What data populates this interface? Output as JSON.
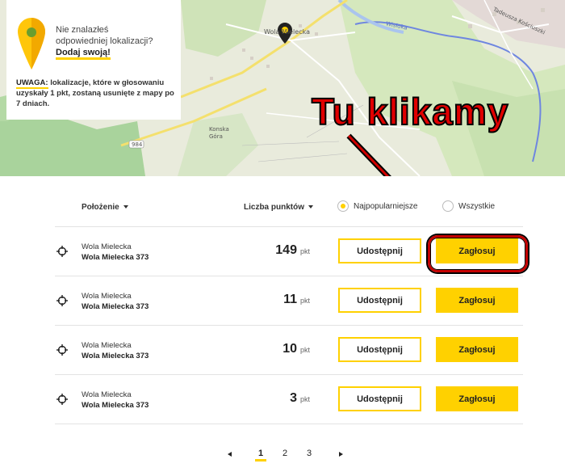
{
  "map": {
    "labels": {
      "place_main": "Wola Mielecka",
      "place_secondary": "Konska Góra",
      "road_number": "984",
      "river": "Wisłoka",
      "street": "Tadeusza Kościuszki"
    }
  },
  "info_card": {
    "line1": "Nie znalazłeś",
    "line2": "odpowiedniej lokalizacji?",
    "add_link": "Dodaj swoją!",
    "warning_label": "UWAGA:",
    "warning_text": "lokalizacje, które w głosowaniu uzyskały 1 pkt, zostaną usunięte z mapy po 7 dniach."
  },
  "annotation": "Tu klikamy",
  "table": {
    "headers": {
      "location": "Położenie",
      "points": "Liczba punktów"
    },
    "filters": {
      "popular": "Najpopularniejsze",
      "all": "Wszystkie",
      "selected": "popular"
    },
    "rows": [
      {
        "place": "Wola Mielecka",
        "address": "Wola Mielecka 373",
        "points": "149",
        "unit": "pkt",
        "share": "Udostępnij",
        "vote": "Zagłosuj"
      },
      {
        "place": "Wola Mielecka",
        "address": "Wola Mielecka 373",
        "points": "11",
        "unit": "pkt",
        "share": "Udostępnij",
        "vote": "Zagłosuj"
      },
      {
        "place": "Wola Mielecka",
        "address": "Wola Mielecka 373",
        "points": "10",
        "unit": "pkt",
        "share": "Udostępnij",
        "vote": "Zagłosuj"
      },
      {
        "place": "Wola Mielecka",
        "address": "Wola Mielecka 373",
        "points": "3",
        "unit": "pkt",
        "share": "Udostępnij",
        "vote": "Zagłosuj"
      }
    ]
  },
  "pagination": {
    "pages": [
      "1",
      "2",
      "3"
    ],
    "current": "1"
  },
  "colors": {
    "accent": "#ffd100",
    "annotation": "#e00000",
    "map_green": "#cfe3b8",
    "map_forest": "#a9d39c",
    "river": "#6e86e0"
  }
}
